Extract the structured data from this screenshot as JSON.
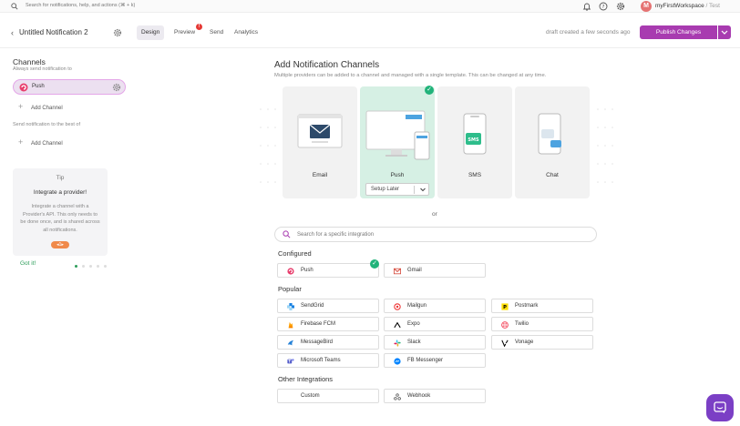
{
  "topbar": {
    "search_placeholder": "Search for notifications, help, and actions (⌘ + k)",
    "avatar_letter": "M",
    "workspace": "myFirstWorkspace",
    "env": "/ Test"
  },
  "header": {
    "back": "‹",
    "title": "Untitled Notification 2",
    "tabs": [
      {
        "label": "Design",
        "active": true
      },
      {
        "label": "Preview",
        "active": false
      },
      {
        "label": "Send",
        "active": false
      },
      {
        "label": "Analytics",
        "active": false
      }
    ],
    "preview_badge": "!",
    "draft_status": "draft created a few seconds ago",
    "publish_label": "Publish Changes"
  },
  "left": {
    "channels_title": "Channels",
    "always_send": "Always send notification to",
    "push_label": "Push",
    "add_channel_1": "Add Channel",
    "best_of": "Send notification to the best of",
    "add_channel_2": "Add Channel",
    "tip": {
      "label": "Tip",
      "title": "Integrate a provider!",
      "body": "Integrate a channel with a Provider's API. This only needs to be done once, and is shared across all notifications.",
      "badge": "◂1▸"
    },
    "got_it": "Got it!"
  },
  "main": {
    "title": "Add Notification Channels",
    "subtitle": "Multiple providers can be added to a channel and managed with a single template. This can be changed at any time.",
    "channels": [
      {
        "label": "Email"
      },
      {
        "label": "Push"
      },
      {
        "label": "SMS"
      },
      {
        "label": "Chat"
      }
    ],
    "setup_later": "Setup Later",
    "or": "or",
    "integration_search": "Search for a specific integration",
    "configured_title": "Configured",
    "configured": [
      {
        "label": "Push"
      },
      {
        "label": "Gmail"
      }
    ],
    "popular_title": "Popular",
    "popular": [
      {
        "label": "SendGrid"
      },
      {
        "label": "Mailgun"
      },
      {
        "label": "Postmark"
      },
      {
        "label": "Firebase FCM"
      },
      {
        "label": "Expo"
      },
      {
        "label": "Twilio"
      },
      {
        "label": "MessageBird"
      },
      {
        "label": "Slack"
      },
      {
        "label": "Vonage"
      },
      {
        "label": "Microsoft Teams"
      },
      {
        "label": "FB Messenger"
      }
    ],
    "other_title": "Other Integrations",
    "other": [
      {
        "label": "Custom"
      },
      {
        "label": "Webhook"
      }
    ]
  },
  "colors": {
    "accent": "#a83bb0",
    "success": "#21b37a",
    "chat_button": "#7b3fc5"
  }
}
